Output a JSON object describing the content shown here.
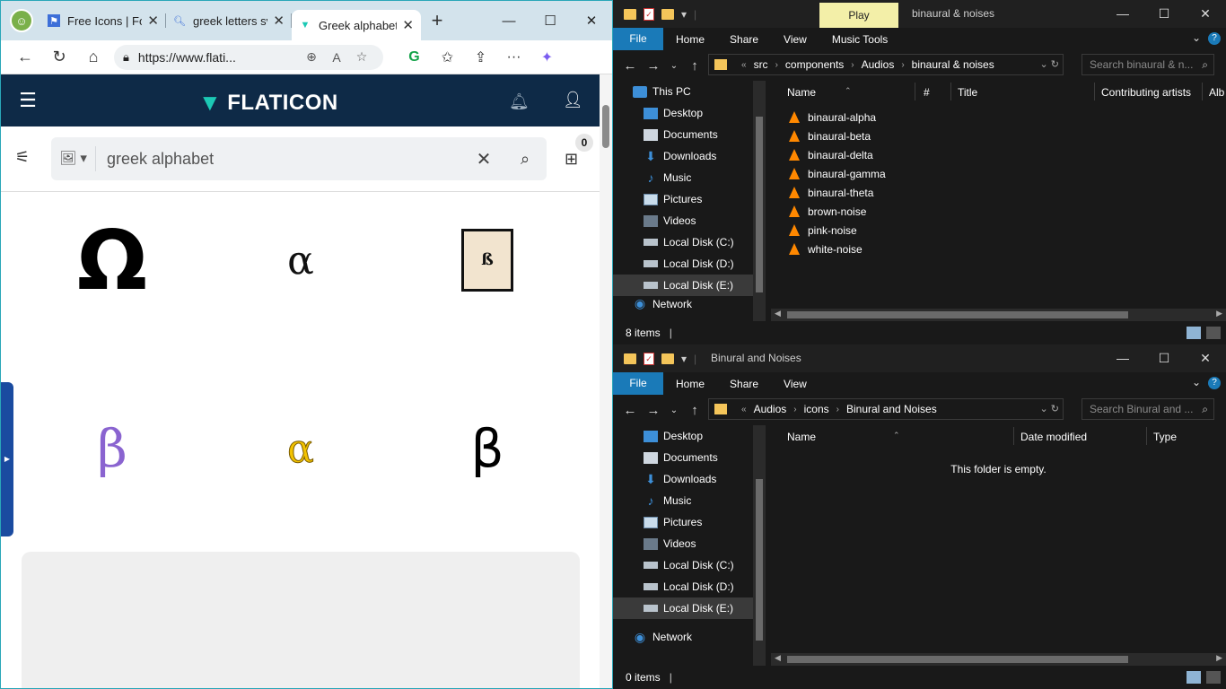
{
  "browser": {
    "tabs": [
      {
        "label": "Free Icons | For"
      },
      {
        "label": "greek letters sv"
      },
      {
        "label": "Greek alphabet"
      }
    ],
    "url": "https://www.flati...",
    "site": {
      "logo": "FLATICON",
      "search_value": "greek alphabet",
      "collection_count": "0",
      "icons": [
        "Ω",
        "α",
        "ß",
        "β",
        "α",
        "β"
      ]
    }
  },
  "explorer_top": {
    "title": "binaural & noises",
    "play_tab": "Play",
    "ribbon": [
      "File",
      "Home",
      "Share",
      "View",
      "Music Tools"
    ],
    "breadcrumb": [
      "src",
      "components",
      "Audios",
      "binaural & noises"
    ],
    "search_placeholder": "Search binaural & n...",
    "nav": [
      "This PC",
      "Desktop",
      "Documents",
      "Downloads",
      "Music",
      "Pictures",
      "Videos",
      "Local Disk (C:)",
      "Local Disk (D:)",
      "Local Disk (E:)",
      "Network"
    ],
    "columns": [
      "Name",
      "#",
      "Title",
      "Contributing artists",
      "Alb"
    ],
    "files": [
      "binaural-alpha",
      "binaural-beta",
      "binaural-delta",
      "binaural-gamma",
      "binaural-theta",
      "brown-noise",
      "pink-noise",
      "white-noise"
    ],
    "status": "8 items"
  },
  "explorer_bottom": {
    "title": "Binural and Noises",
    "ribbon": [
      "File",
      "Home",
      "Share",
      "View"
    ],
    "breadcrumb": [
      "Audios",
      "icons",
      "Binural and Noises"
    ],
    "search_placeholder": "Search Binural and ...",
    "nav": [
      "Desktop",
      "Documents",
      "Downloads",
      "Music",
      "Pictures",
      "Videos",
      "Local Disk (C:)",
      "Local Disk (D:)",
      "Local Disk (E:)",
      "Network"
    ],
    "columns": [
      "Name",
      "Date modified",
      "Type"
    ],
    "empty_message": "This folder is empty.",
    "status": "0 items"
  }
}
